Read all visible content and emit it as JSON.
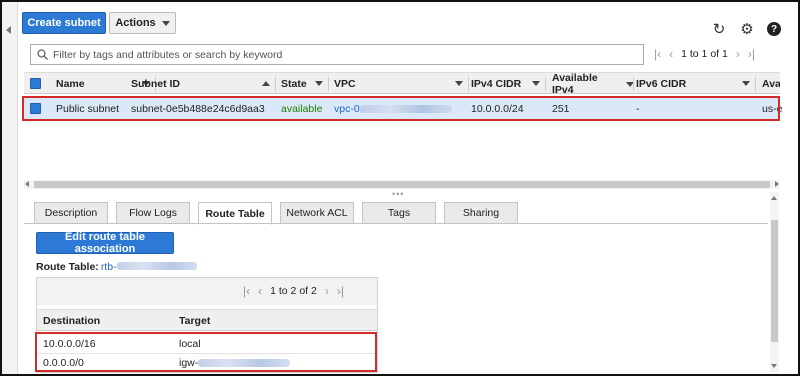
{
  "toolbar": {
    "create_label": "Create subnet",
    "actions_label": "Actions"
  },
  "filter": {
    "placeholder": "Filter by tags and attributes or search by keyword",
    "pager_text": "1 to 1 of 1"
  },
  "subnet_table": {
    "columns": [
      "Name",
      "Subnet ID",
      "State",
      "VPC",
      "IPv4 CIDR",
      "Available IPv4",
      "IPv6 CIDR",
      "Avai"
    ],
    "row": {
      "name": "Public subnet",
      "subnet_id": "subnet-0e5b488e24c6d9aa3",
      "state": "available",
      "vpc": "vpc-0",
      "ipv4_cidr": "10.0.0.0/24",
      "available_ipv4": "251",
      "ipv6_cidr": "-",
      "avail_zone": "us-e"
    }
  },
  "tabs": [
    "Description",
    "Flow Logs",
    "Route Table",
    "Network ACL",
    "Tags",
    "Sharing"
  ],
  "active_tab": "Route Table",
  "route_panel": {
    "edit_label": "Edit route table association",
    "route_table_label": "Route Table:",
    "route_table_id": "rtb-",
    "pager_text": "1 to 2 of 2",
    "columns": [
      "Destination",
      "Target"
    ],
    "rows": [
      {
        "destination": "10.0.0.0/16",
        "target": "local"
      },
      {
        "destination": "0.0.0.0/0",
        "target": "igw-"
      }
    ]
  },
  "colors": {
    "primary": "#2c7ad6",
    "link": "#1f66c2",
    "available": "#1d8102",
    "highlight_box": "#d42a2a",
    "selected_row": "#dbe8f8"
  },
  "icons": [
    "refresh-icon",
    "gear-icon",
    "help-icon",
    "search-icon",
    "first-page-icon",
    "prev-page-icon",
    "next-page-icon",
    "last-page-icon"
  ]
}
